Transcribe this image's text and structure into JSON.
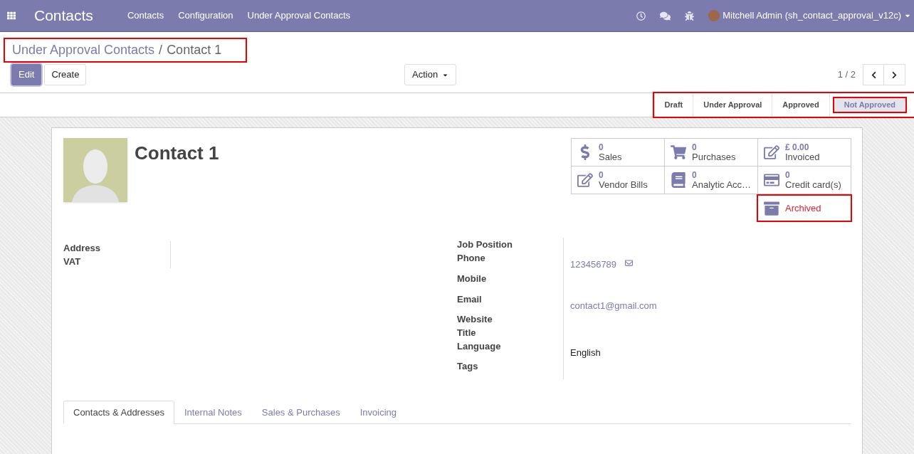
{
  "navbar": {
    "app_title": "Contacts",
    "menu": [
      "Contacts",
      "Configuration",
      "Under Approval Contacts"
    ],
    "user": "Mitchell Admin (sh_contact_approval_v12c)"
  },
  "breadcrumb": {
    "highlighted": true,
    "items": [
      {
        "label": "Under Approval Contacts",
        "kind": "link"
      },
      {
        "label": "/",
        "kind": "separator"
      },
      {
        "label": "Contact 1",
        "kind": "current"
      }
    ]
  },
  "buttons": [
    {
      "label": "Edit",
      "primary": true
    },
    {
      "label": "Create",
      "primary": false
    }
  ],
  "action_menu": "Action",
  "pager": "1 / 2",
  "statusbar": {
    "highlighted": true,
    "stages": [
      {
        "label": "Draft",
        "selected": false,
        "highlighted": false
      },
      {
        "label": "Under Approval",
        "selected": false,
        "highlighted": false
      },
      {
        "label": "Approved",
        "selected": false,
        "highlighted": false
      },
      {
        "label": "Not Approved",
        "selected": true,
        "highlighted": true
      }
    ]
  },
  "contact": {
    "name": "Contact 1"
  },
  "smart_buttons": [
    {
      "kind": "dollar",
      "value": "0",
      "label": "Sales"
    },
    {
      "kind": "cart",
      "value": "0",
      "label": "Purchases"
    },
    {
      "kind": "edit",
      "value": "£ 0.00",
      "label": "Invoiced"
    },
    {
      "kind": "edit",
      "value": "0",
      "label": "Vendor Bills"
    },
    {
      "kind": "book",
      "value": "0",
      "label": "Analytic Acc…"
    },
    {
      "kind": "card",
      "value": "0",
      "label": "Credit card(s)"
    }
  ],
  "archived": {
    "label": "Archived",
    "highlighted": true
  },
  "left_fields": [
    {
      "label": "Address"
    },
    {
      "label": "VAT"
    }
  ],
  "right_fields": [
    {
      "label": "Job Position",
      "kind": "text"
    },
    {
      "label": "Phone",
      "value": "123456789",
      "kind": "phone"
    },
    {
      "label": "Mobile",
      "kind": "phone"
    },
    {
      "label": "Email",
      "value": "contact1@gmail.com",
      "kind": "email"
    },
    {
      "label": "Website",
      "kind": "text"
    },
    {
      "label": "Title",
      "kind": "text"
    },
    {
      "label": "Language",
      "value": "English",
      "kind": "select"
    },
    {
      "label": "Tags",
      "kind": "tags"
    }
  ],
  "tabs": [
    {
      "label": "Contacts & Addresses",
      "selected": true
    },
    {
      "label": "Internal Notes",
      "selected": false
    },
    {
      "label": "Sales & Purchases",
      "selected": false
    },
    {
      "label": "Invoicing",
      "selected": false
    }
  ]
}
